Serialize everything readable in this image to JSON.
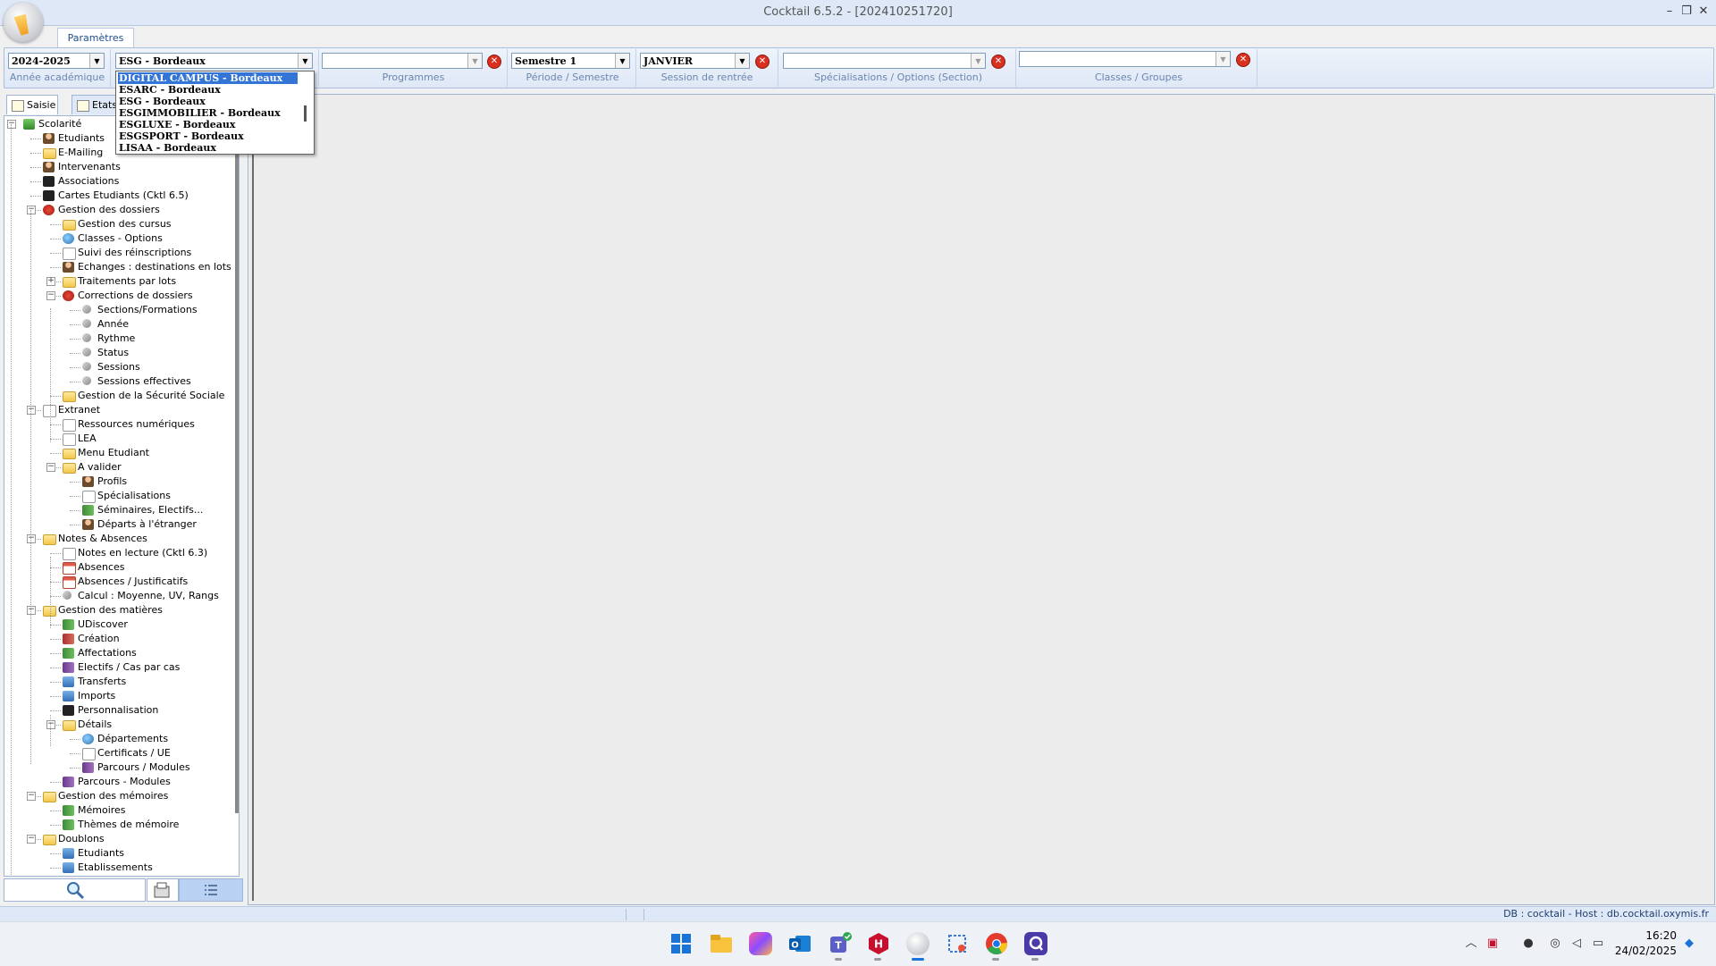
{
  "window": {
    "title": "Cocktail 6.5.2 -    [202410251720]",
    "controls": {
      "minimize": "–",
      "restore": "❐",
      "close": "✕"
    }
  },
  "ribbon": {
    "tab_label": "Paramètres",
    "fields": {
      "annee": {
        "value": "2024-2025",
        "label": "Année académique"
      },
      "ecole": {
        "value": "ESG - Bordeaux"
      },
      "programmes": {
        "value": "",
        "label": "Programmes"
      },
      "periode": {
        "value": "Semestre 1",
        "label": "Période / Semestre"
      },
      "session": {
        "value": "JANVIER",
        "label": "Session de rentrée"
      },
      "specialisations": {
        "value": "",
        "label": "Spécialisations / Options (Section)"
      },
      "classes": {
        "value": "",
        "label": "Classes / Groupes"
      }
    },
    "dropdown_items": [
      "DIGITAL CAMPUS - Bordeaux",
      "ESARC - Bordeaux",
      "ESG - Bordeaux",
      "ESGIMMOBILIER - Bordeaux",
      "ESGLUXE - Bordeaux",
      "ESGSPORT - Bordeaux",
      "LISAA - Bordeaux"
    ]
  },
  "left_panel": {
    "tabs": {
      "saisie": "Saisie",
      "etats": "Etats"
    },
    "tree": [
      {
        "label": "Scolarité",
        "icon": "green-leaf-icon"
      },
      {
        "label": "Etudiants",
        "icon": "student-icon"
      },
      {
        "label": "E-Mailing",
        "icon": "mail-folder-icon"
      },
      {
        "label": "Intervenants",
        "icon": "teacher-icon"
      },
      {
        "label": "Associations",
        "icon": "football-icon"
      },
      {
        "label": "Cartes Etudiants (Cktl 6.5)",
        "icon": "camera-icon"
      },
      {
        "label": "Gestion des dossiers",
        "icon": "folders-icon"
      },
      {
        "label": "Gestion des cursus",
        "icon": "cursus-icon"
      },
      {
        "label": "Classes - Options",
        "icon": "classes-icon"
      },
      {
        "label": "Suivi des réinscriptions",
        "icon": "reinscription-icon"
      },
      {
        "label": "Echanges : destinations en lots",
        "icon": "exchange-icon"
      },
      {
        "label": "Traitements par lots",
        "icon": "folder-icon"
      },
      {
        "label": "Corrections de dossiers",
        "icon": "corrections-icon"
      },
      {
        "label": "Sections/Formations",
        "icon": "wrench-icon"
      },
      {
        "label": "Année",
        "icon": "wrench-icon"
      },
      {
        "label": "Rythme",
        "icon": "wrench-icon"
      },
      {
        "label": "Status",
        "icon": "wrench-icon"
      },
      {
        "label": "Sessions",
        "icon": "wrench-icon"
      },
      {
        "label": "Sessions effectives",
        "icon": "wrench-icon"
      },
      {
        "label": "Gestion de la Sécurité Sociale",
        "icon": "folder-icon"
      },
      {
        "label": "Extranet",
        "icon": "extranet-icon"
      },
      {
        "label": "Ressources numériques",
        "icon": "extranet-icon"
      },
      {
        "label": "LEA",
        "icon": "extranet-icon"
      },
      {
        "label": "Menu Etudiant",
        "icon": "folder-icon"
      },
      {
        "label": "A valider",
        "icon": "folder-icon"
      },
      {
        "label": "Profils",
        "icon": "profile-icon"
      },
      {
        "label": "Spécialisations",
        "icon": "specialisation-icon"
      },
      {
        "label": "Séminaires, Electifs...",
        "icon": "books-icon"
      },
      {
        "label": "Départs à l'étranger",
        "icon": "departure-icon"
      },
      {
        "label": "Notes & Absences",
        "icon": "folder-icon"
      },
      {
        "label": "Notes en lecture (Cktl 6.3)",
        "icon": "notes-icon"
      },
      {
        "label": "Absences",
        "icon": "calendar-icon"
      },
      {
        "label": "Absences / Justificatifs",
        "icon": "calendar-icon"
      },
      {
        "label": "Calcul : Moyenne, UV, Rangs",
        "icon": "calculator-icon"
      },
      {
        "label": "Gestion des matières",
        "icon": "folder-icon"
      },
      {
        "label": "UDiscover",
        "icon": "green-books-icon"
      },
      {
        "label": "Création",
        "icon": "red-books-icon"
      },
      {
        "label": "Affectations",
        "icon": "green-books-icon"
      },
      {
        "label": "Electifs / Cas par cas",
        "icon": "purple-books-icon"
      },
      {
        "label": "Transferts",
        "icon": "transfer-icon"
      },
      {
        "label": "Imports",
        "icon": "import-icon"
      },
      {
        "label": "Personnalisation",
        "icon": "dark-books-icon"
      },
      {
        "label": "Détails",
        "icon": "folder-icon"
      },
      {
        "label": "Départements",
        "icon": "departments-icon"
      },
      {
        "label": "Certificats / UE",
        "icon": "certificate-icon"
      },
      {
        "label": "Parcours / Modules",
        "icon": "purple-books-icon"
      },
      {
        "label": "Parcours - Modules",
        "icon": "purple-books-icon"
      },
      {
        "label": "Gestion des mémoires",
        "icon": "folder-icon"
      },
      {
        "label": "Mémoires",
        "icon": "green-books-icon"
      },
      {
        "label": "Thèmes de mémoire",
        "icon": "green-books-icon"
      },
      {
        "label": "Doublons",
        "icon": "folder-icon"
      },
      {
        "label": "Etudiants",
        "icon": "duplicate-student-icon"
      },
      {
        "label": "Etablissements",
        "icon": "duplicate-school-icon"
      }
    ]
  },
  "status_bar": {
    "text": "DB : cocktail - Host : db.cocktail.oxymis.fr"
  },
  "taskbar": {
    "clock_time": "16:20",
    "clock_date": "24/02/2025"
  }
}
